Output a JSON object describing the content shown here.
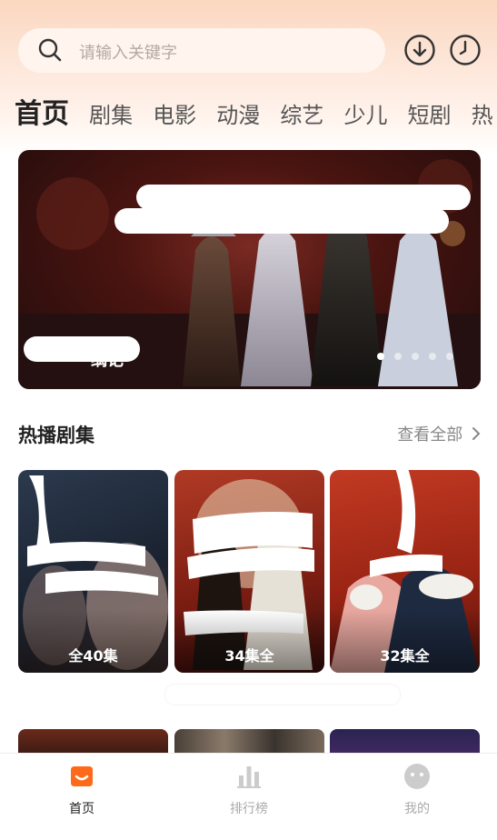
{
  "search": {
    "placeholder": "请输入关键字"
  },
  "icons": {
    "download": "download-icon",
    "history": "history-clock-icon",
    "search": "search-icon"
  },
  "tabs": [
    {
      "label": "首页",
      "active": true
    },
    {
      "label": "剧集"
    },
    {
      "label": "电影"
    },
    {
      "label": "动漫"
    },
    {
      "label": "综艺"
    },
    {
      "label": "少儿"
    },
    {
      "label": "短剧"
    },
    {
      "label": "热"
    }
  ],
  "banner": {
    "caption": "缡记",
    "pages": 5,
    "current_page": 1
  },
  "hot_section": {
    "title": "热播剧集",
    "view_all": "查看全部",
    "cards": [
      {
        "episodes": "全40集"
      },
      {
        "episodes": "34集全"
      },
      {
        "episodes": "32集全"
      }
    ]
  },
  "bottom_nav": [
    {
      "label": "首页",
      "icon": "home-icon",
      "active": true
    },
    {
      "label": "排行榜",
      "icon": "ranking-icon"
    },
    {
      "label": "我的",
      "icon": "profile-icon"
    }
  ],
  "colors": {
    "accent": "#ff6a1a",
    "nav_inactive": "#cccccc"
  }
}
